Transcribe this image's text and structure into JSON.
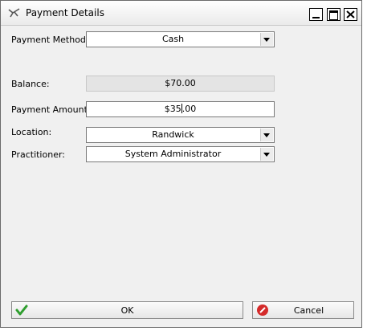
{
  "window": {
    "title": "Payment Details",
    "controls": {
      "minimize": "minimize-icon",
      "maximize": "maximize-icon",
      "close": "close-icon"
    }
  },
  "form": {
    "payment_method": {
      "label": "Payment Method:",
      "value": "Cash"
    },
    "balance": {
      "label": "Balance:",
      "value": "$70.00"
    },
    "payment_amount": {
      "label": "Payment Amount:",
      "value_before_caret": "$35",
      "value_after_caret": ".00"
    },
    "location": {
      "label": "Location:",
      "value": "Randwick"
    },
    "practitioner": {
      "label": "Practitioner:",
      "value": "System Administrator"
    }
  },
  "buttons": {
    "ok": {
      "label": "OK",
      "icon": "checkmark-icon",
      "icon_color": "#2f9e2f"
    },
    "cancel": {
      "label": "Cancel",
      "icon": "cancel-icon",
      "icon_color": "#d42a2a"
    }
  }
}
